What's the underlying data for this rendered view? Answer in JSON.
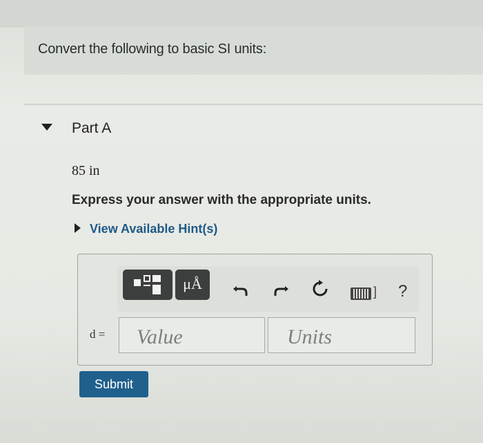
{
  "intro": {
    "text": "Convert the following to basic SI units:"
  },
  "part": {
    "title": "Part A",
    "given": "85 in",
    "instruction": "Express your answer with the appropriate units.",
    "hint_link": "View Available Hint(s)"
  },
  "toolbar": {
    "templates_icon": "templates-icon",
    "units_label": "μÅ",
    "undo_icon": "undo-icon",
    "redo_icon": "redo-icon",
    "reset_icon": "reset-icon",
    "keyboard_icon": "keyboard-icon",
    "keyboard_suffix": "]",
    "help_label": "?"
  },
  "answer": {
    "variable_label": "d =",
    "value_placeholder": "Value",
    "units_placeholder": "Units"
  },
  "submit": {
    "label": "Submit"
  },
  "colors": {
    "link": "#1f5a88",
    "submit_bg": "#20608c",
    "tool_dark": "#3d3f3e"
  }
}
